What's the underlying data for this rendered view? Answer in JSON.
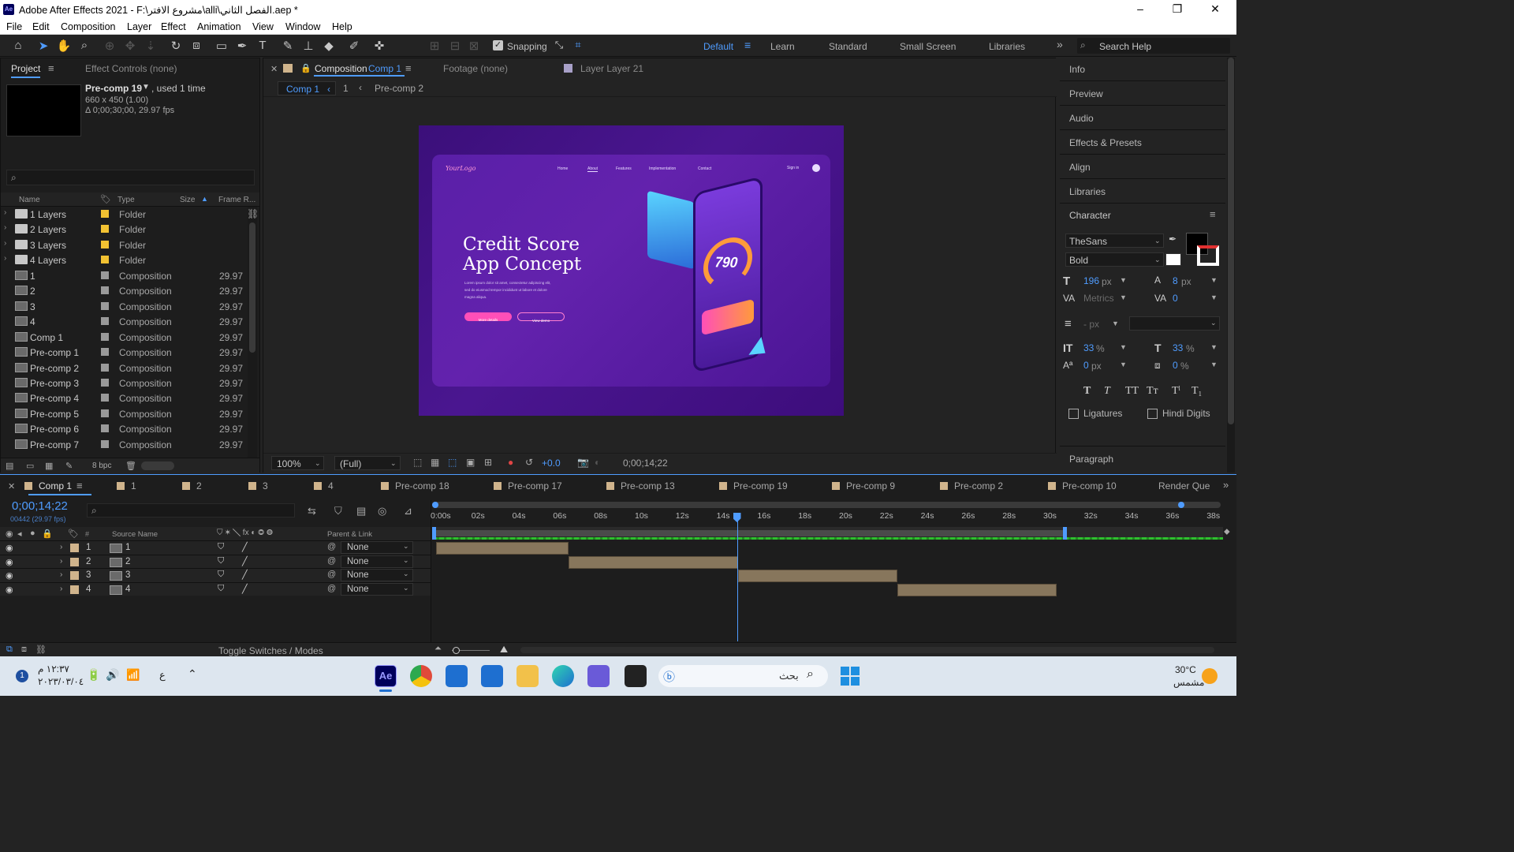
{
  "window": {
    "title": "Adobe After Effects 2021 - F:\\مشروع الافتر\\alli\\الفصل الثاني.aep *",
    "app_icon": "Ae"
  },
  "menu": [
    "File",
    "Edit",
    "Composition",
    "Layer",
    "Effect",
    "Animation",
    "View",
    "Window",
    "Help"
  ],
  "toolbar": {
    "snapping": "Snapping",
    "workspaces": [
      "Default",
      "Learn",
      "Standard",
      "Small Screen",
      "Libraries"
    ],
    "search_placeholder": "Search Help"
  },
  "project": {
    "tab": "Project",
    "effect_controls": "Effect Controls (none)",
    "selected_name": "Pre-comp 19",
    "selected_used": ", used 1 time",
    "selected_dims": "660 x 450 (1.00)",
    "selected_dur": "Δ 0;00;30;00, 29.97 fps",
    "columns": {
      "name": "Name",
      "type": "Type",
      "size": "Size",
      "frame": "Frame R..."
    },
    "items": [
      {
        "name": "1 Layers",
        "type": "Folder",
        "fps": "",
        "kind": "folder"
      },
      {
        "name": "2 Layers",
        "type": "Folder",
        "fps": "",
        "kind": "folder"
      },
      {
        "name": "3 Layers",
        "type": "Folder",
        "fps": "",
        "kind": "folder"
      },
      {
        "name": "4 Layers",
        "type": "Folder",
        "fps": "",
        "kind": "folder"
      },
      {
        "name": "1",
        "type": "Composition",
        "fps": "29.97",
        "kind": "comp"
      },
      {
        "name": "2",
        "type": "Composition",
        "fps": "29.97",
        "kind": "comp"
      },
      {
        "name": "3",
        "type": "Composition",
        "fps": "29.97",
        "kind": "comp"
      },
      {
        "name": "4",
        "type": "Composition",
        "fps": "29.97",
        "kind": "comp"
      },
      {
        "name": "Comp 1",
        "type": "Composition",
        "fps": "29.97",
        "kind": "comp"
      },
      {
        "name": "Pre-comp 1",
        "type": "Composition",
        "fps": "29.97",
        "kind": "comp"
      },
      {
        "name": "Pre-comp 2",
        "type": "Composition",
        "fps": "29.97",
        "kind": "comp"
      },
      {
        "name": "Pre-comp 3",
        "type": "Composition",
        "fps": "29.97",
        "kind": "comp"
      },
      {
        "name": "Pre-comp 4",
        "type": "Composition",
        "fps": "29.97",
        "kind": "comp"
      },
      {
        "name": "Pre-comp 5",
        "type": "Composition",
        "fps": "29.97",
        "kind": "comp"
      },
      {
        "name": "Pre-comp 6",
        "type": "Composition",
        "fps": "29.97",
        "kind": "comp"
      },
      {
        "name": "Pre-comp 7",
        "type": "Composition",
        "fps": "29.97",
        "kind": "comp"
      }
    ],
    "bpc": "8 bpc"
  },
  "viewer": {
    "tab_prefix": "Composition",
    "tab_comp": "Comp 1",
    "footage": "Footage (none)",
    "layer_tab": "Layer  Layer 21",
    "breadcrumb": [
      "Comp 1",
      "1",
      "Pre-comp 2"
    ],
    "zoom": "100%",
    "resolution": "(Full)",
    "exposure": "+0.0",
    "timecode": "0;00;14;22",
    "art": {
      "logo": "YourLogo",
      "nav": [
        "Home",
        "About",
        "Features",
        "Implementation",
        "Contact"
      ],
      "sign_in": "Sign in",
      "headline_1": "Credit Score",
      "headline_2": "App Concept",
      "body_1": "Lorem ipsum dolor sit amet, consectetur adipiscing elit,",
      "body_2": "sed do eiusmod tempor incididunt ut labore et dolore",
      "body_3": "magna aliqua.",
      "btn_1": "More details",
      "btn_2": "View demo",
      "score": "790"
    }
  },
  "right_panels": [
    "Info",
    "Preview",
    "Audio",
    "Effects & Presets",
    "Align",
    "Libraries"
  ],
  "character": {
    "title": "Character",
    "font": "TheSans",
    "style": "Bold",
    "size": "196",
    "size_unit": "px",
    "leading": "8",
    "leading_unit": "px",
    "kerning": "Metrics",
    "tracking": "0",
    "stroke_unit": "- px",
    "vscale": "33",
    "hscale": "33",
    "baseline": "0",
    "baseline_unit": "px",
    "tsume": "0",
    "ligatures": "Ligatures",
    "hindi_digits": "Hindi Digits",
    "paragraph": "Paragraph",
    "colors": {
      "fill": "#000000",
      "stroke": "#ffffff"
    }
  },
  "timeline": {
    "tabs": [
      "Comp 1",
      "1",
      "2",
      "3",
      "4",
      "Pre-comp 18",
      "Pre-comp 17",
      "Pre-comp 13",
      "Pre-comp 19",
      "Pre-comp 9",
      "Pre-comp 2",
      "Pre-comp 10",
      "Render Que"
    ],
    "timecode": "0;00;14;22",
    "frames": "00442 (29.97 fps)",
    "col_source": "Source Name",
    "col_parent": "Parent & Link",
    "ruler": [
      "0:00s",
      "02s",
      "04s",
      "06s",
      "08s",
      "10s",
      "12s",
      "14s",
      "16s",
      "18s",
      "20s",
      "22s",
      "24s",
      "26s",
      "28s",
      "30s",
      "32s",
      "34s",
      "36s",
      "38s"
    ],
    "layers": [
      {
        "num": "1",
        "name": "1",
        "parent": "None",
        "start": 0,
        "end": 6.5
      },
      {
        "num": "2",
        "name": "2",
        "parent": "None",
        "start": 6.5,
        "end": 14.8
      },
      {
        "num": "3",
        "name": "3",
        "parent": "None",
        "start": 14.8,
        "end": 22.6
      },
      {
        "num": "4",
        "name": "4",
        "parent": "None",
        "start": 22.6,
        "end": 30.4
      }
    ],
    "current_time_s": 14.73,
    "toggle": "Toggle Switches / Modes"
  },
  "taskbar": {
    "time": "١٢:٣٧ م",
    "date": "٢٠٢٣/٠٣/٠٤",
    "lang": "ع",
    "search": "بحث",
    "weather_temp": "30°C",
    "weather_desc": "مشمس",
    "notif": "1"
  }
}
